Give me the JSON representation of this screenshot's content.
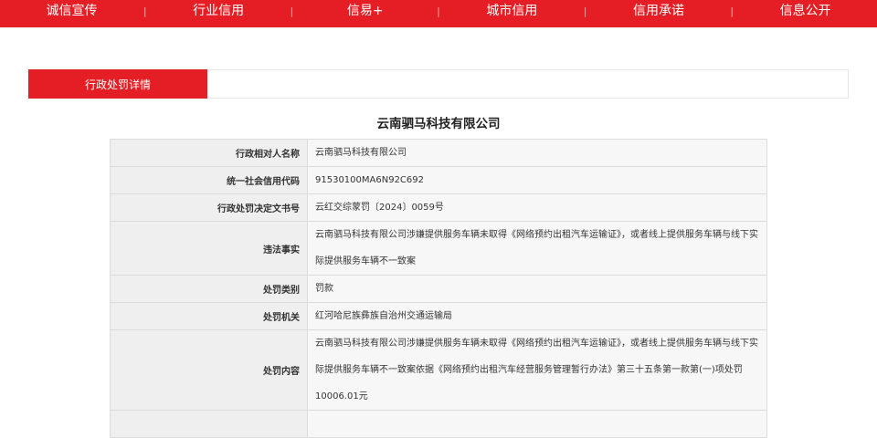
{
  "nav": {
    "items": [
      "诚信宣传",
      "行业信用",
      "信易+",
      "城市信用",
      "信用承诺",
      "信息公开"
    ],
    "separator": "|"
  },
  "tab": {
    "label": "行政处罚详情"
  },
  "company_title": "云南驷马科技有限公司",
  "details": {
    "rows": [
      {
        "label": "行政相对人名称",
        "value": "云南驷马科技有限公司"
      },
      {
        "label": "统一社会信用代码",
        "value": "91530100MA6N92C692"
      },
      {
        "label": "行政处罚决定文书号",
        "value": "云红交综蒙罚〔2024〕0059号"
      },
      {
        "label": "违法事实",
        "value": "云南驷马科技有限公司涉嫌提供服务车辆未取得《网络预约出租汽车运输证》，或者线上提供服务车辆与线下实际提供服务车辆不一致案"
      },
      {
        "label": "处罚类别",
        "value": "罚款"
      },
      {
        "label": "处罚机关",
        "value": "红河哈尼族彝族自治州交通运输局"
      },
      {
        "label": "处罚内容",
        "value": "云南驷马科技有限公司涉嫌提供服务车辆未取得《网络预约出租汽车运输证》，或者线上提供服务车辆与线下实际提供服务车辆不一致案依据《网络预约出租汽车经营服务管理暂行办法》第三十五条第一款第(一)项处罚10006.01元"
      }
    ]
  },
  "colors": {
    "brand_red": "#e41e24"
  }
}
